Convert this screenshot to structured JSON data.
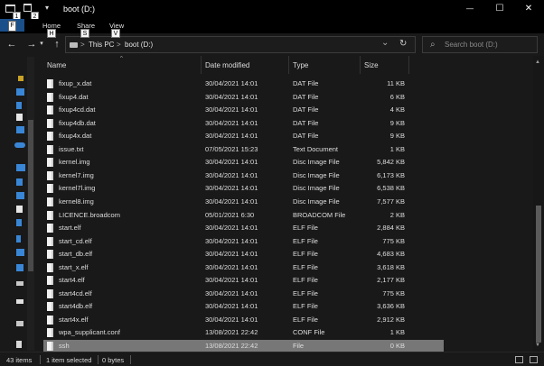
{
  "window": {
    "title": "boot (D:)",
    "controls": {
      "minimize": "—",
      "maximize": "☐",
      "close": "✕"
    }
  },
  "quick_access": {
    "keytip_1": "1",
    "keytip_2": "2",
    "dropdown": "▾"
  },
  "ribbon": {
    "file_label": "F",
    "tabs": [
      {
        "label": "Home",
        "keytip": "H"
      },
      {
        "label": "Share",
        "keytip": "S"
      },
      {
        "label": "View",
        "keytip": "V"
      }
    ]
  },
  "navigation": {
    "back": "←",
    "forward": "→",
    "recent": "▾",
    "up": "↑",
    "breadcrumb": [
      "This PC",
      "boot (D:)"
    ],
    "separator": ">",
    "dropdown": "⌄",
    "refresh": "↻"
  },
  "search": {
    "placeholder": "Search boot (D:)"
  },
  "columns": {
    "name": "Name",
    "date": "Date modified",
    "type": "Type",
    "size": "Size"
  },
  "files": [
    {
      "name": "fixup_x.dat",
      "date": "30/04/2021 14:01",
      "type": "DAT File",
      "size": "11 KB"
    },
    {
      "name": "fixup4.dat",
      "date": "30/04/2021 14:01",
      "type": "DAT File",
      "size": "6 KB"
    },
    {
      "name": "fixup4cd.dat",
      "date": "30/04/2021 14:01",
      "type": "DAT File",
      "size": "4 KB"
    },
    {
      "name": "fixup4db.dat",
      "date": "30/04/2021 14:01",
      "type": "DAT File",
      "size": "9 KB"
    },
    {
      "name": "fixup4x.dat",
      "date": "30/04/2021 14:01",
      "type": "DAT File",
      "size": "9 KB"
    },
    {
      "name": "issue.txt",
      "date": "07/05/2021 15:23",
      "type": "Text Document",
      "size": "1 KB"
    },
    {
      "name": "kernel.img",
      "date": "30/04/2021 14:01",
      "type": "Disc Image File",
      "size": "5,842 KB"
    },
    {
      "name": "kernel7.img",
      "date": "30/04/2021 14:01",
      "type": "Disc Image File",
      "size": "6,173 KB"
    },
    {
      "name": "kernel7l.img",
      "date": "30/04/2021 14:01",
      "type": "Disc Image File",
      "size": "6,538 KB"
    },
    {
      "name": "kernel8.img",
      "date": "30/04/2021 14:01",
      "type": "Disc Image File",
      "size": "7,577 KB"
    },
    {
      "name": "LICENCE.broadcom",
      "date": "05/01/2021 6:30",
      "type": "BROADCOM File",
      "size": "2 KB"
    },
    {
      "name": "start.elf",
      "date": "30/04/2021 14:01",
      "type": "ELF File",
      "size": "2,884 KB"
    },
    {
      "name": "start_cd.elf",
      "date": "30/04/2021 14:01",
      "type": "ELF File",
      "size": "775 KB"
    },
    {
      "name": "start_db.elf",
      "date": "30/04/2021 14:01",
      "type": "ELF File",
      "size": "4,683 KB"
    },
    {
      "name": "start_x.elf",
      "date": "30/04/2021 14:01",
      "type": "ELF File",
      "size": "3,618 KB"
    },
    {
      "name": "start4.elf",
      "date": "30/04/2021 14:01",
      "type": "ELF File",
      "size": "2,177 KB"
    },
    {
      "name": "start4cd.elf",
      "date": "30/04/2021 14:01",
      "type": "ELF File",
      "size": "775 KB"
    },
    {
      "name": "start4db.elf",
      "date": "30/04/2021 14:01",
      "type": "ELF File",
      "size": "3,636 KB"
    },
    {
      "name": "start4x.elf",
      "date": "30/04/2021 14:01",
      "type": "ELF File",
      "size": "2,912 KB"
    },
    {
      "name": "wpa_supplicant.conf",
      "date": "13/08/2021 22:42",
      "type": "CONF File",
      "size": "1 KB"
    },
    {
      "name": "ssh",
      "date": "13/08/2021 22:42",
      "type": "File",
      "size": "0 KB",
      "selected": true
    }
  ],
  "status": {
    "item_count": "43 items",
    "selection": "1 item selected",
    "selection_size": "0 bytes"
  },
  "colors": {
    "background": "#191919",
    "selection": "#777777",
    "file_tab": "#1a4f8a"
  },
  "icons": [
    "file-icon",
    "folder-icon",
    "drive-icon",
    "search-icon",
    "refresh-icon",
    "up-arrow-icon",
    "details-view-icon",
    "large-icons-view-icon"
  ]
}
